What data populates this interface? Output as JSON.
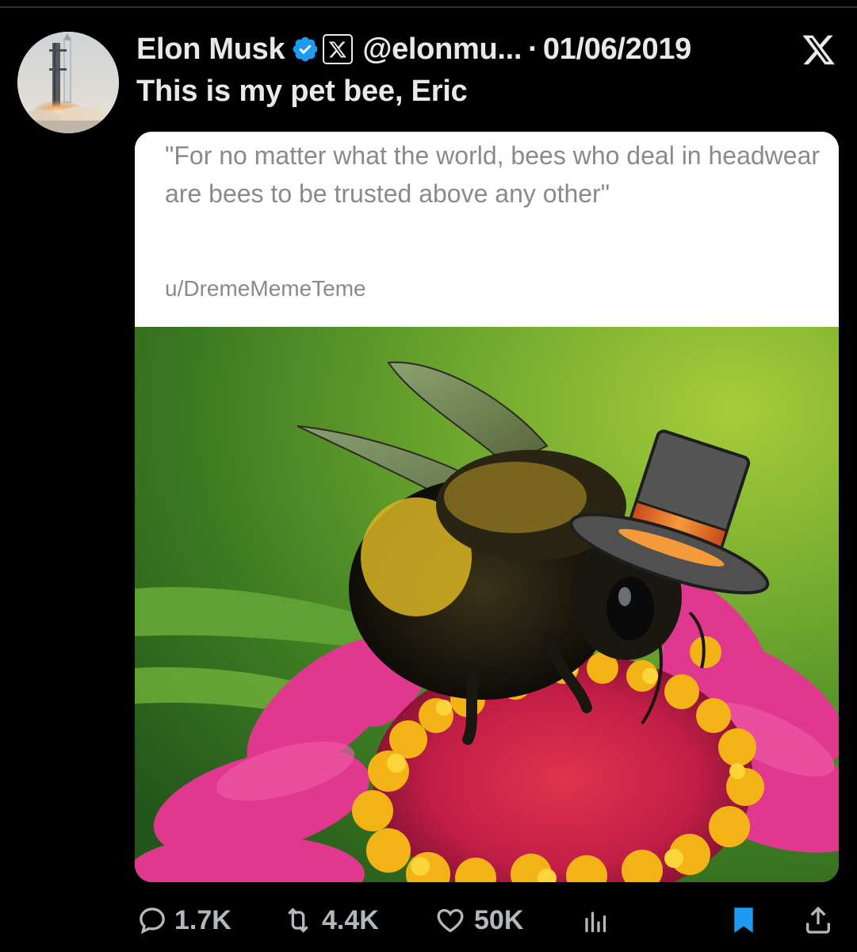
{
  "tweet": {
    "author_name": "Elon Musk",
    "handle": "@elonmu...",
    "separator": "·",
    "date": "01/06/2019",
    "text": "This is my pet bee, Eric"
  },
  "quote": {
    "text": "\"For no matter what the world, bees who deal in headwear are bees to be trusted above any other\"",
    "author": "u/DremeMemeTeme"
  },
  "actions": {
    "replies": "1.7K",
    "reposts": "4.4K",
    "likes": "50K"
  },
  "icons": {
    "verified": "verified-badge-icon",
    "affiliation": "x-affiliation-icon",
    "brand": "x-logo-icon",
    "reply": "reply-icon",
    "repost": "repost-icon",
    "like": "heart-icon",
    "views": "views-chart-icon",
    "bookmark": "bookmark-icon",
    "share": "share-icon"
  },
  "colors": {
    "background": "#000000",
    "text": "#e7e9ea",
    "muted": "#b3b8bd",
    "verified_blue": "#1d9bf0",
    "bookmark_blue": "#1d9bf0"
  }
}
